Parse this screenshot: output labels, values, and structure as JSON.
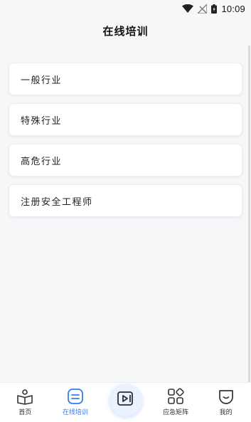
{
  "status_bar": {
    "time": "10:09",
    "icons": [
      "wifi-icon",
      "no-signal-icon",
      "battery-icon"
    ]
  },
  "header": {
    "title": "在线培训"
  },
  "training_list": [
    {
      "label": "一般行业"
    },
    {
      "label": "特殊行业"
    },
    {
      "label": "高危行业"
    },
    {
      "label": "注册安全工程师"
    }
  ],
  "bottom_nav": {
    "items": [
      {
        "label": "首页",
        "icon": "home-book-icon",
        "active": false
      },
      {
        "label": "在线培训",
        "icon": "training-icon",
        "active": true
      },
      {
        "label": "",
        "icon": "video-play-icon",
        "active": false
      },
      {
        "label": "应急矩阵",
        "icon": "matrix-icon",
        "active": false
      },
      {
        "label": "我的",
        "icon": "profile-icon",
        "active": false
      }
    ]
  },
  "colors": {
    "accent": "#2f7ff0",
    "background": "#f6f7f9",
    "card": "#ffffff"
  }
}
